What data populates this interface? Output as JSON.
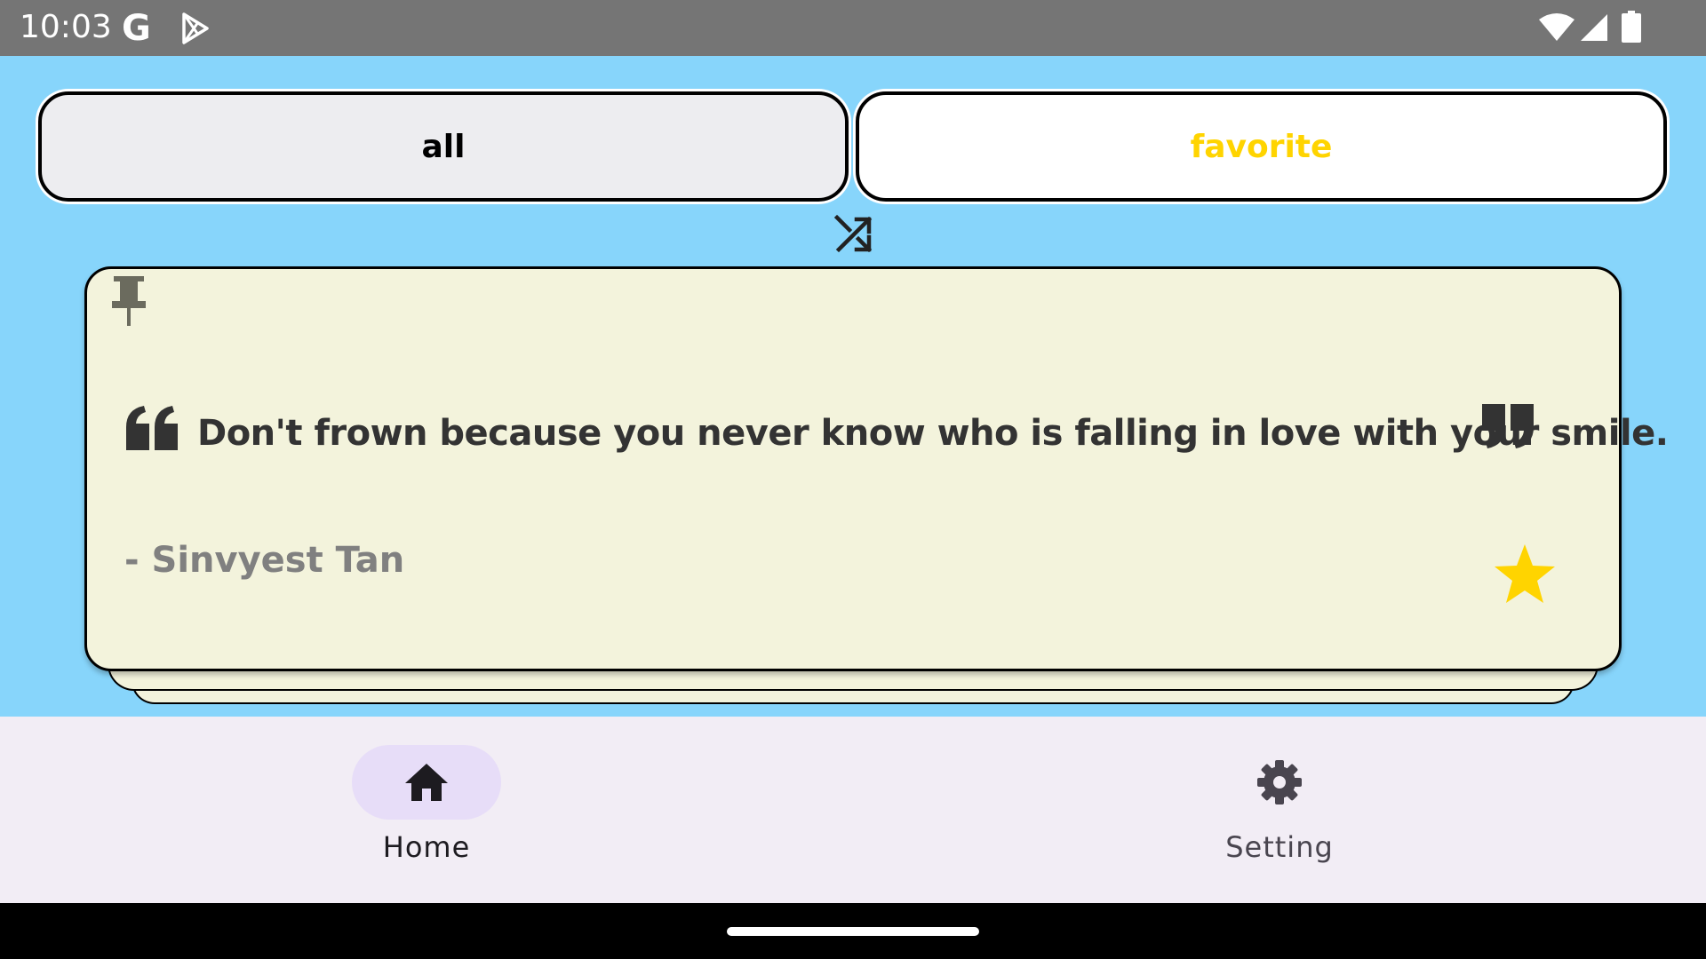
{
  "status_bar": {
    "time": "10:03",
    "google_glyph": "G",
    "icons": [
      "google-icon",
      "play-store-icon",
      "wifi-icon",
      "signal-icon",
      "battery-icon"
    ]
  },
  "tabs": {
    "all_label": "all",
    "favorite_label": "favorite",
    "favorite_color": "#FFD400"
  },
  "quote_card": {
    "text": "Don't frown because you never know who is falling in love with your smile.",
    "author": "- Sinvyest Tan",
    "favorited": true,
    "card_color": "#F3F3DC"
  },
  "bottom_nav": {
    "items": [
      {
        "label": "Home",
        "icon": "home-icon",
        "selected": true
      },
      {
        "label": "Setting",
        "icon": "gear-icon",
        "selected": false
      }
    ]
  },
  "colors": {
    "background": "#87D5FB",
    "star": "#FFD400",
    "nav_background": "#F2EDF5",
    "nav_selected_pill": "#E7DDF8"
  }
}
